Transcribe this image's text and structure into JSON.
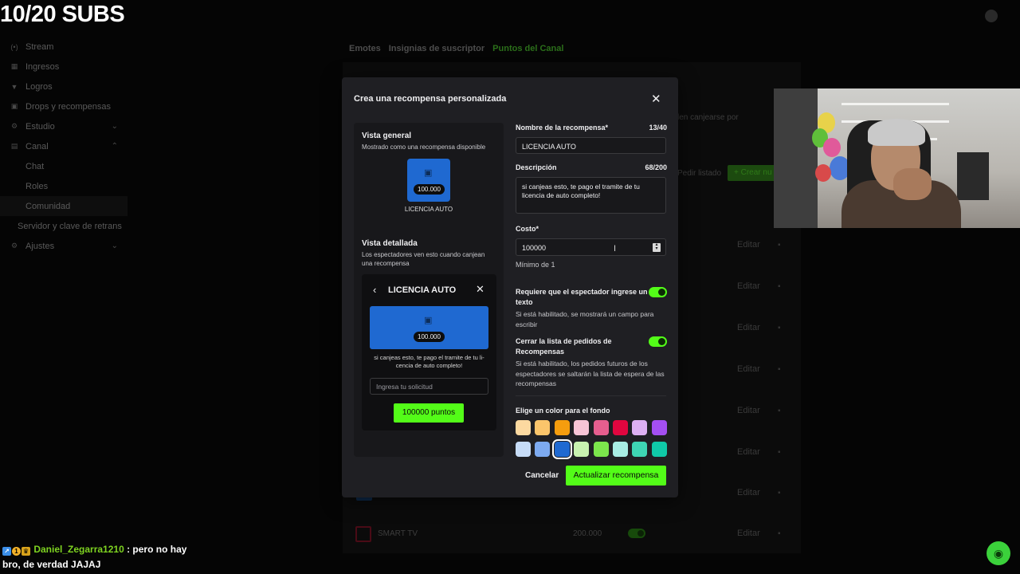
{
  "overlay": {
    "subs_goal": "10/20 SUBS"
  },
  "sidebar": {
    "items": [
      {
        "icon": "stream-icon",
        "glyph": "(•)",
        "label": "Stream"
      },
      {
        "icon": "revenue-icon",
        "glyph": "▦",
        "label": "Ingresos"
      },
      {
        "icon": "trophy-icon",
        "glyph": "🏆",
        "label": "Logros"
      },
      {
        "icon": "gift-icon",
        "glyph": "▣",
        "label": "Drops y recompensas"
      },
      {
        "icon": "studio-icon",
        "glyph": "⚙",
        "label": "Estudio"
      },
      {
        "icon": "channel-icon",
        "glyph": "▤",
        "label": "Canal"
      },
      {
        "label": "Chat"
      },
      {
        "label": "Roles"
      },
      {
        "label": "Comunidad"
      },
      {
        "label": "Servidor y clave de retrans"
      },
      {
        "icon": "settings-icon",
        "glyph": "⚙",
        "label": "Ajustes"
      }
    ]
  },
  "tabs": [
    {
      "label": "Emotes"
    },
    {
      "label": "Insignias de suscriptor"
    },
    {
      "label": "Puntos del Canal"
    }
  ],
  "background": {
    "partial_text_1": "len canjearse por",
    "partial_text_2": "Pedir listado",
    "create_button": "+ Crear nu",
    "edit_label": "Editar",
    "smart_row": {
      "name": "SMART TV",
      "cost": "200.000"
    }
  },
  "modal": {
    "title": "Crea una recompensa personalizada",
    "preview": {
      "general_heading": "Vista general",
      "general_sub": "Mostrado como una recompensa disponible",
      "card_cost": "100.000",
      "card_label": "LICENCIA AUTO",
      "detail_heading": "Vista detallada",
      "detail_sub": "Los espectadores ven esto cuando canjean una recompensa",
      "detail_title": "LICENCIA AUTO",
      "detail_cost": "100.000",
      "detail_description": "si canjeas esto, te pago el tramite de tu li-cencia de auto completo!",
      "request_placeholder": "Ingresa tu solicitud",
      "redeem_button": "100000 puntos"
    },
    "form": {
      "name_label": "Nombre de la recompensa*",
      "name_count": "13/40",
      "name_value": "LICENCIA AUTO",
      "description_label": "Descripción",
      "description_count": "68/200",
      "description_value": "si canjeas esto, te pago el tramite de tu licencia de auto completo!",
      "cost_label": "Costo*",
      "cost_value": "100000",
      "cost_min": "Mínimo de 1",
      "require_text_label": "Requiere que el espectador ingrese un texto",
      "require_text_help": "Si está habilitado, se mostrará un campo para escribir",
      "require_text_on": true,
      "close_queue_label": "Cerrar la lista de pedidos de Recompensas",
      "close_queue_help": "Si está habilitado, los pedidos futuros de los espectadores se saltarán la lista de espera de las recompensas",
      "close_queue_on": true,
      "color_label": "Elige un color para el fondo",
      "colors": [
        "#fcd9a0",
        "#fbc56b",
        "#f59d0e",
        "#f7c4d6",
        "#e65e8e",
        "#e1063f",
        "#ddb0f2",
        "#a44ff2",
        "#c7dcf7",
        "#7daaf0",
        "#1f69d1",
        "#c8f2b0",
        "#7ce64c",
        "#a8ede4",
        "#3ed6b4",
        "#0fc9a8"
      ],
      "selected_color": "#1f69d1",
      "cancel_label": "Cancelar",
      "submit_label": "Actualizar recompensa"
    }
  },
  "chat": {
    "username": "Daniel_Zegarra1210",
    "message": ": pero no hay bro, de verdad JAJAJ",
    "badge_number": "1"
  }
}
